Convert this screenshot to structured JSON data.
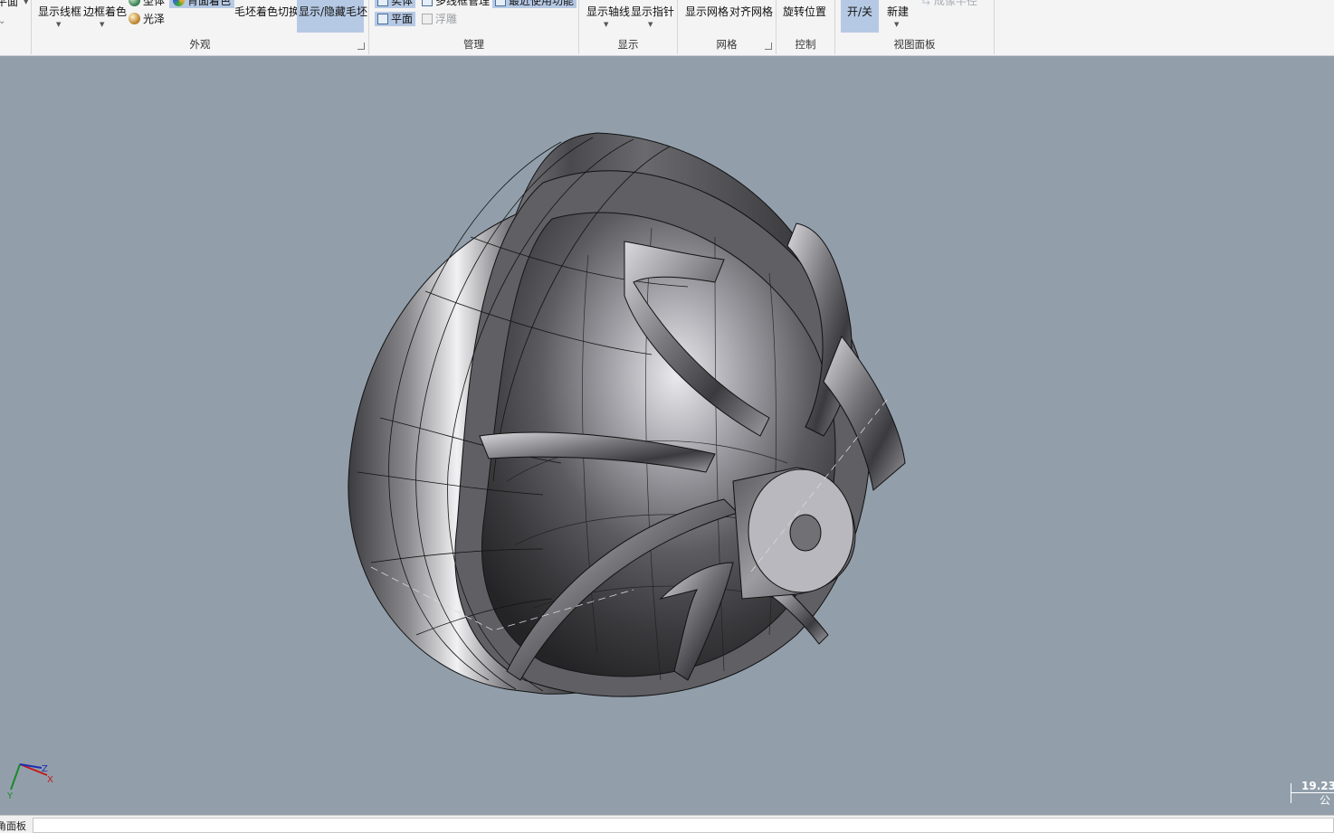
{
  "ribbon": {
    "prev_fragment": "平面",
    "appearance": {
      "label": "外观",
      "show_wireframe": "显示线框",
      "edge_shading": "边框着色",
      "shading_top": "型体",
      "gloss": "光泽",
      "shade_mode": "背面着色",
      "blank_shade_switch": "毛坯着色切换",
      "toggle_blank": "显示/隐藏毛坯"
    },
    "manage": {
      "label": "管理",
      "solid": "实体",
      "plane": "平面",
      "wireframe_manager": "多线框管理",
      "float": "浮雕",
      "recent": "最近使用功能"
    },
    "display": {
      "label": "显示",
      "show_axis": "显示轴线",
      "show_pointer": "显示指针"
    },
    "grid": {
      "label": "网格",
      "show_grid": "显示网格",
      "snap_grid": "对齐网格"
    },
    "control": {
      "label": "控制",
      "rotate_position": "旋转位置"
    },
    "view_panel": {
      "label": "视图面板",
      "toggle": "开/关",
      "new": "新建",
      "remove": "成像半径"
    }
  },
  "viewport": {
    "background": "#929fab",
    "axes": {
      "x": "X",
      "y": "Y",
      "z": "Z"
    },
    "scale_value": "19.23",
    "scale_unit": "公"
  },
  "bottom": {
    "panel_tab": "角面板"
  }
}
